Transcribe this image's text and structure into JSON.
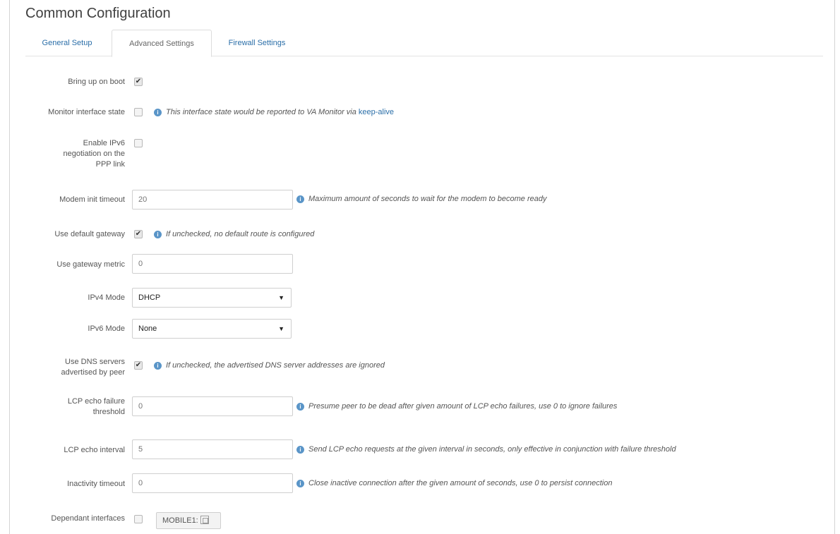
{
  "section_title": "Common Configuration",
  "tabs": [
    {
      "label": "General Setup",
      "active": false
    },
    {
      "label": "Advanced Settings",
      "active": true
    },
    {
      "label": "Firewall Settings",
      "active": false
    }
  ],
  "fields": {
    "bring_up_on_boot": {
      "label": "Bring up on boot",
      "checked": true
    },
    "monitor_interface_state": {
      "label": "Monitor interface state",
      "checked": false,
      "hint": "This interface state would be reported to VA Monitor via ",
      "hint_link": "keep-alive"
    },
    "enable_ipv6": {
      "label": "Enable IPv6 negotiation on the PPP link",
      "checked": false
    },
    "modem_init_timeout": {
      "label": "Modem init timeout",
      "placeholder": "20",
      "hint": "Maximum amount of seconds to wait for the modem to become ready"
    },
    "use_default_gateway": {
      "label": "Use default gateway",
      "checked": true,
      "hint": "If unchecked, no default route is configured"
    },
    "use_gateway_metric": {
      "label": "Use gateway metric",
      "placeholder": "0"
    },
    "ipv4_mode": {
      "label": "IPv4 Mode",
      "value": "DHCP"
    },
    "ipv6_mode": {
      "label": "IPv6 Mode",
      "value": "None"
    },
    "use_dns_servers": {
      "label": "Use DNS servers advertised by peer",
      "checked": true,
      "hint": "If unchecked, the advertised DNS server addresses are ignored"
    },
    "lcp_echo_failure": {
      "label": "LCP echo failure threshold",
      "placeholder": "0",
      "hint": "Presume peer to be dead after given amount of LCP echo failures, use 0 to ignore failures"
    },
    "lcp_echo_interval": {
      "label": "LCP echo interval",
      "placeholder": "5",
      "hint": "Send LCP echo requests at the given interval in seconds, only effective in conjunction with failure threshold"
    },
    "inactivity_timeout": {
      "label": "Inactivity timeout",
      "placeholder": "0",
      "hint": "Close inactive connection after the given amount of seconds, use 0 to persist connection"
    },
    "dependant_interfaces": {
      "label": "Dependant interfaces",
      "checked": false,
      "tag": "MOBILE1:"
    }
  },
  "glyphs": {
    "check": "✔",
    "info": "i",
    "caret": "▼"
  }
}
